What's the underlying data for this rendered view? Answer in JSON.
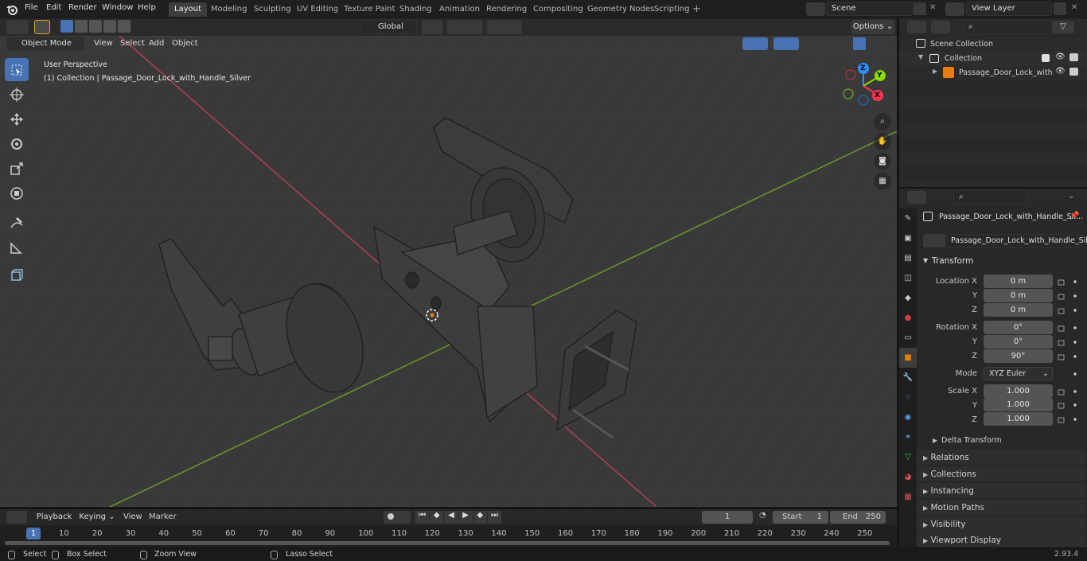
{
  "menus": [
    "File",
    "Edit",
    "Render",
    "Window",
    "Help"
  ],
  "workspace_tabs": [
    "Layout",
    "Modeling",
    "Sculpting",
    "UV Editing",
    "Texture Paint",
    "Shading",
    "Animation",
    "Rendering",
    "Compositing",
    "Geometry Nodes",
    "Scripting"
  ],
  "active_tab": "Layout",
  "scene_name": "Scene",
  "view_layer": "View Layer",
  "viewport": {
    "mode": "Object Mode",
    "header_menus": [
      "View",
      "Select",
      "Add",
      "Object"
    ],
    "orientation": "Global",
    "options_label": "Options",
    "perspective_label": "User Perspective",
    "collection_label": "(1) Collection | Passage_Door_Lock_with_Handle_Silver",
    "gizmo_axes": {
      "x": "X",
      "y": "Y",
      "z": "Z"
    }
  },
  "outliner": {
    "scene_collection": "Scene Collection",
    "collection": "Collection",
    "object": "Passage_Door_Lock_with"
  },
  "properties": {
    "object_header": "Passage_Door_Lock_with_Handle_Sil...",
    "object_name": "Passage_Door_Lock_with_Handle_Silver",
    "transform_title": "Transform",
    "location_label": "Location X",
    "rotation_label": "Rotation X",
    "scale_label": "Scale X",
    "axis_y": "Y",
    "axis_z": "Z",
    "location": [
      "0 m",
      "0 m",
      "0 m"
    ],
    "rotation": [
      "0°",
      "0°",
      "90°"
    ],
    "mode_label": "Mode",
    "mode_value": "XYZ Euler",
    "scale": [
      "1.000",
      "1.000",
      "1.000"
    ],
    "delta": "Delta Transform",
    "panels": [
      "Relations",
      "Collections",
      "Instancing",
      "Motion Paths",
      "Visibility",
      "Viewport Display"
    ]
  },
  "timeline": {
    "menus": [
      "Playback",
      "Keying",
      "View",
      "Marker"
    ],
    "current_frame": "1",
    "start_label": "Start",
    "start": "1",
    "end_label": "End",
    "end": "250",
    "frame_marks": [
      "10",
      "20",
      "30",
      "40",
      "50",
      "60",
      "70",
      "80",
      "90",
      "100",
      "110",
      "120",
      "130",
      "140",
      "150",
      "160",
      "170",
      "180",
      "190",
      "200",
      "210",
      "220",
      "230",
      "240",
      "250"
    ]
  },
  "status": {
    "select": "Select",
    "box_select": "Box Select",
    "zoom_view": "Zoom View",
    "lasso_select": "Lasso Select",
    "version": "2.93.4"
  },
  "colors": {
    "accent": "#4772b3",
    "x_axis": "#ff3352",
    "y_axis": "#8bdc00",
    "z_axis": "#2890ff",
    "orange": "#e87d0d"
  }
}
